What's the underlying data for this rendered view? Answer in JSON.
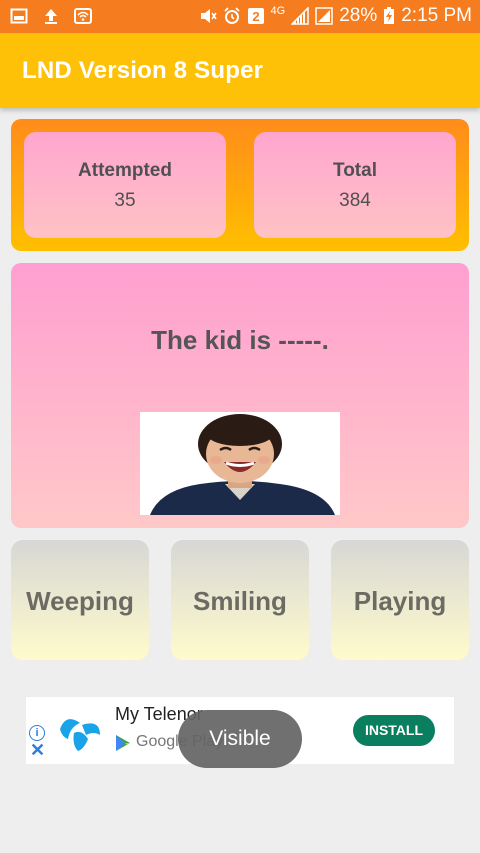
{
  "status_bar": {
    "network": "4G",
    "battery_percent": "28%",
    "time": "2:15 PM",
    "icons": [
      "gallery-icon",
      "upload-icon",
      "wifi-icon",
      "mute-icon",
      "alarm-icon",
      "sim2-icon",
      "signal-icon",
      "signal-icon",
      "battery-charging-icon"
    ]
  },
  "app_bar": {
    "title": "LND Version 8 Super"
  },
  "stats": {
    "attempted_label": "Attempted",
    "attempted_value": "35",
    "total_label": "Total",
    "total_value": "384"
  },
  "question": {
    "text": "The kid is -----.",
    "image": "smiling-child-photo"
  },
  "answers": [
    "Weeping",
    "Smiling",
    "Playing"
  ],
  "ad": {
    "app_name": "My Telenor",
    "store": "Google Play",
    "install_label": "INSTALL",
    "colors": {
      "install": "#0a7f5f",
      "logo": "#1aa3e8"
    }
  },
  "toast": {
    "text": "Visible"
  },
  "colors": {
    "status_bar": "#f57c1f",
    "app_bar": "#ffc107"
  }
}
